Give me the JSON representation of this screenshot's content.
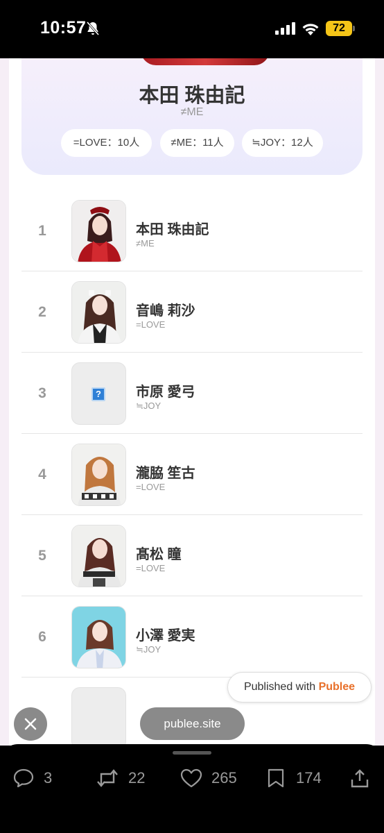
{
  "status_bar": {
    "time": "10:57",
    "battery": "72"
  },
  "profile": {
    "name": "本田 珠由記",
    "group": "≠ME",
    "chips": [
      "=LOVE：10人",
      "≠ME：11人",
      "≒JOY：12人"
    ]
  },
  "ranking": [
    {
      "rank": "1",
      "name": "本田 珠由記",
      "group": "≠ME"
    },
    {
      "rank": "2",
      "name": "音嶋 莉沙",
      "group": "=LOVE"
    },
    {
      "rank": "3",
      "name": "市原 愛弓",
      "group": "≒JOY"
    },
    {
      "rank": "4",
      "name": "瀧脇 笙古",
      "group": "=LOVE"
    },
    {
      "rank": "5",
      "name": "髙松 瞳",
      "group": "=LOVE"
    },
    {
      "rank": "6",
      "name": "小澤 愛実",
      "group": "≒JOY"
    }
  ],
  "badge": {
    "prefix": "Published with ",
    "brand": "Publee",
    "brand_color": "#e8702a"
  },
  "site_pill": "publee.site",
  "actions": {
    "replies": "3",
    "reposts": "22",
    "likes": "265",
    "bookmarks": "174"
  },
  "icons": [
    "bell-slash-icon",
    "signal-icon",
    "wifi-icon",
    "battery-icon",
    "question-icon",
    "close-icon",
    "reply-icon",
    "repost-icon",
    "heart-icon",
    "bookmark-icon",
    "share-icon"
  ]
}
